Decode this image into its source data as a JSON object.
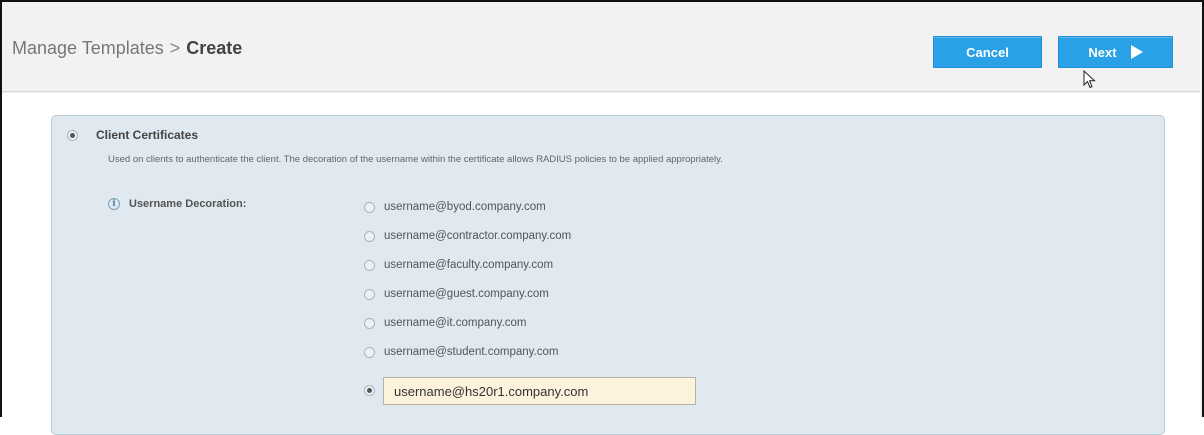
{
  "header": {
    "breadcrumb_parent": "Manage Templates",
    "breadcrumb_separator": ">",
    "breadcrumb_current": "Create",
    "cancel_label": "Cancel",
    "next_label": "Next"
  },
  "panel": {
    "title": "Client Certificates",
    "description": "Used on clients to authenticate the client. The decoration of the username within the certificate allows RADIUS policies to be applied appropriately.",
    "field_label": "Username Decoration:",
    "info_icon": "info-icon",
    "options": [
      "username@byod.company.com",
      "username@contractor.company.com",
      "username@faculty.company.com",
      "username@guest.company.com",
      "username@it.company.com",
      "username@student.company.com"
    ],
    "custom_value": "username@hs20r1.company.com",
    "selected": "custom"
  },
  "colors": {
    "accent": "#2aa0e6",
    "panel_bg": "#dfe9ef",
    "input_bg": "#fdf3dd"
  }
}
